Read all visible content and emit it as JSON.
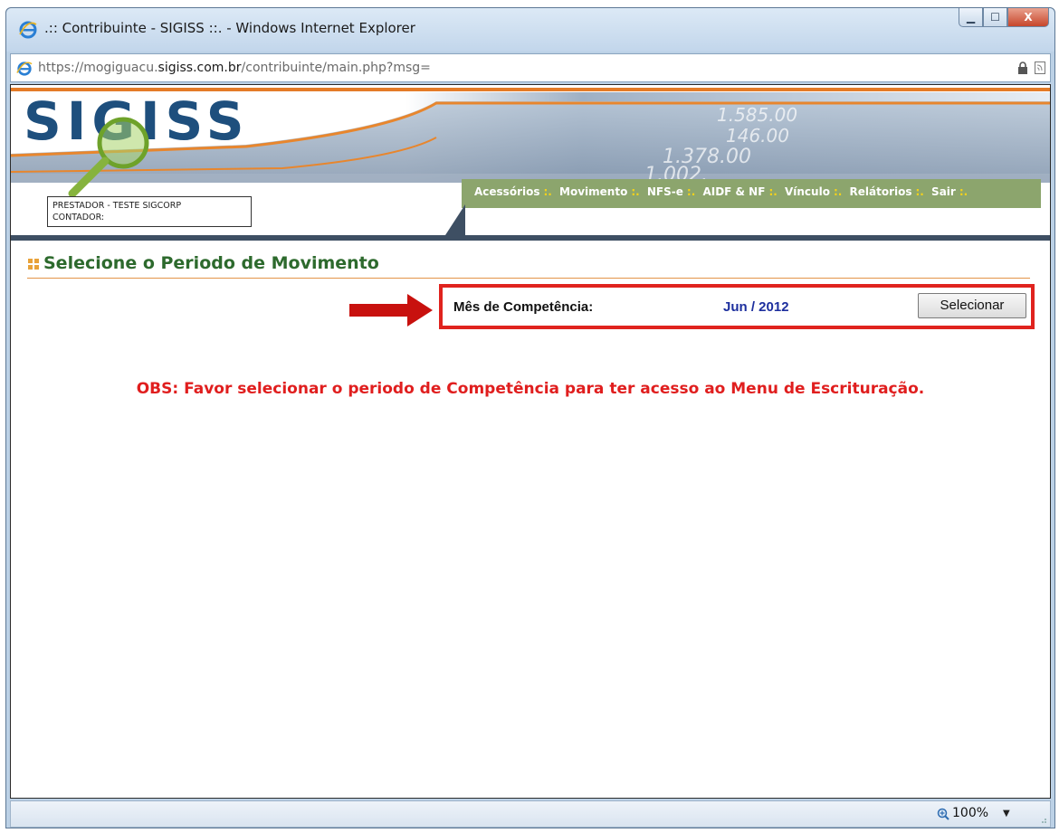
{
  "window": {
    "title": ".:: Contribuinte - SIGISS ::. - Windows Internet Explorer",
    "minimize_label": "▁",
    "maximize_label": "☐",
    "close_label": "X"
  },
  "address": {
    "scheme": "https://",
    "host_prefix": "mogiguacu.",
    "host_main": "sigiss.com.br",
    "path": "/contribuinte/main.php?msg="
  },
  "banner": {
    "logo": "SIGISS",
    "user_line1": "PRESTADOR - TESTE SIGCORP",
    "user_line2": "CONTADOR:",
    "menu": {
      "items": [
        "Acessórios",
        "Movimento",
        "NFS-e",
        "AIDF & NF",
        "Vínculo",
        "Relátorios",
        "Sair"
      ],
      "separator": ":."
    },
    "bg_numbers": [
      "1.585.00",
      "146.00",
      "1.378.00",
      "1.002."
    ]
  },
  "section": {
    "title": "Selecione o Periodo de Movimento"
  },
  "competencia": {
    "label": "Mês de Competência:",
    "value": "Jun / 2012",
    "button": "Selecionar"
  },
  "obs": "OBS: Favor selecionar o periodo de Competência para ter acesso ao Menu de Escrituração.",
  "status": {
    "zoom": "100%"
  },
  "colors": {
    "menu_bg": "#8ca56d",
    "highlight_red": "#e0231e",
    "section_green": "#2d6a2d",
    "obs_red": "#e01e1e",
    "value_blue": "#1d2f9e"
  }
}
